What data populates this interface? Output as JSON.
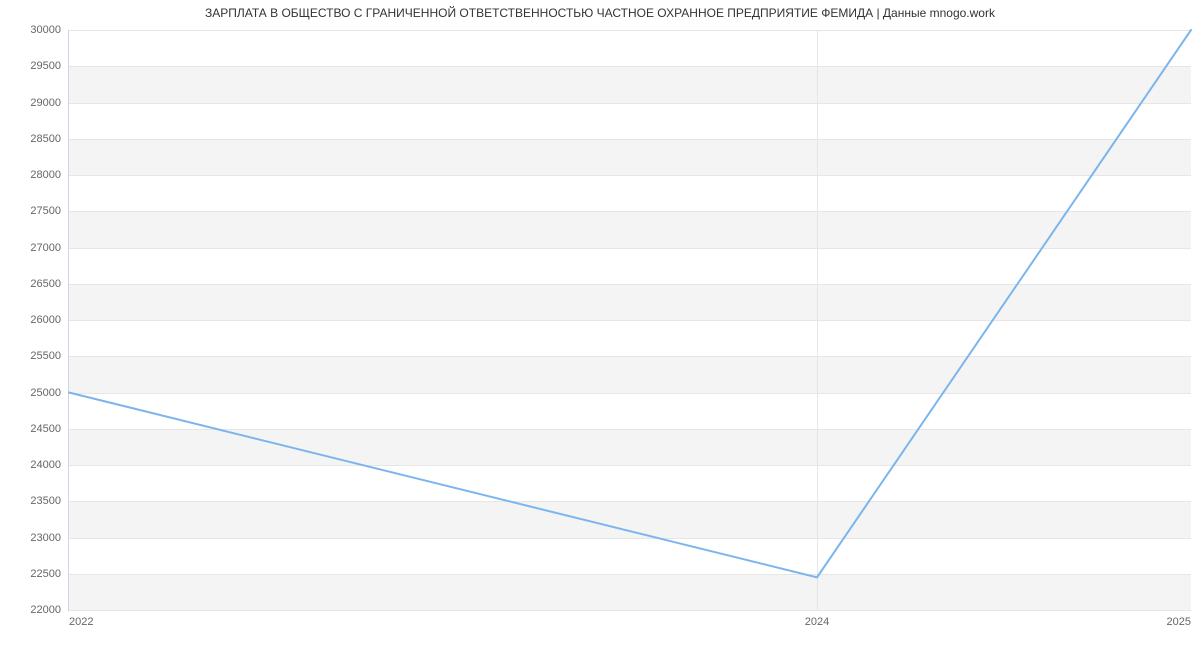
{
  "chart_data": {
    "type": "line",
    "title": "ЗАРПЛАТА В ОБЩЕСТВО С ГРАНИЧЕННОЙ ОТВЕТСТВЕННОСТЬЮ ЧАСТНОЕ ОХРАННОЕ ПРЕДПРИЯТИЕ ФЕМИДА | Данные mnogo.work",
    "xlabel": "",
    "ylabel": "",
    "x": [
      2022,
      2024,
      2025
    ],
    "values": [
      25000,
      22450,
      30000
    ],
    "x_ticks": [
      2022,
      2024,
      2025
    ],
    "y_ticks": [
      22000,
      22500,
      23000,
      23500,
      24000,
      24500,
      25000,
      25500,
      26000,
      26500,
      27000,
      27500,
      28000,
      28500,
      29000,
      29500,
      30000
    ],
    "xlim": [
      2022,
      2025
    ],
    "ylim": [
      22000,
      30000
    ],
    "line_color": "#7cb5ec"
  }
}
